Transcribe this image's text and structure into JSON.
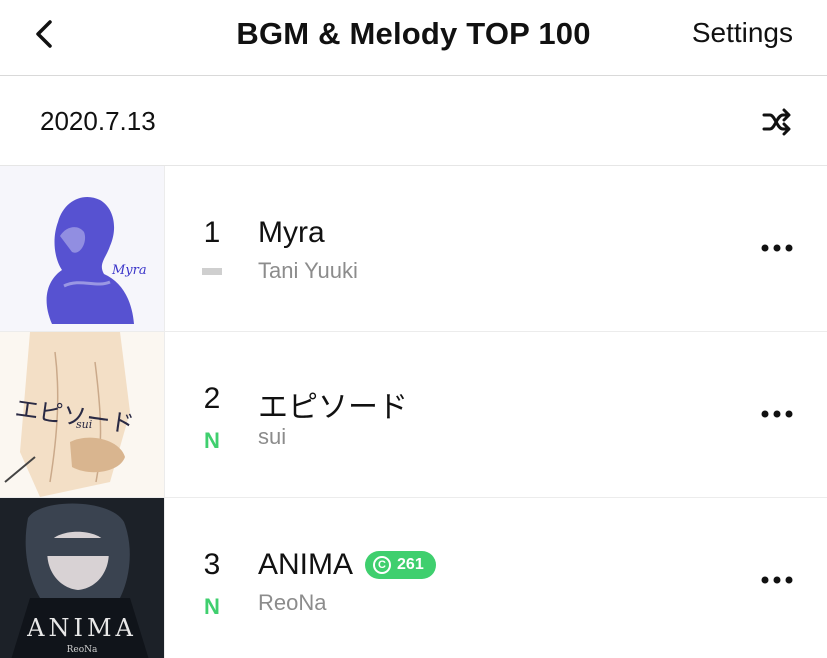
{
  "header": {
    "back_icon": "chevron-left-icon",
    "title": "BGM & Melody TOP 100",
    "settings_label": "Settings"
  },
  "date_bar": {
    "date": "2020.7.13",
    "shuffle_icon": "shuffle-icon"
  },
  "tracks": [
    {
      "rank": "1",
      "movement": "",
      "title": "Myra",
      "artist": "Tani Yuuki",
      "badge": "",
      "art_text": "Myra"
    },
    {
      "rank": "2",
      "movement": "N",
      "title": "エピソード",
      "artist": "sui",
      "badge": "",
      "art_text": "エピソード",
      "art_subtext": "sui"
    },
    {
      "rank": "3",
      "movement": "N",
      "title": "ANIMA",
      "artist": "ReoNa",
      "badge": "261",
      "art_text": "ANIMA",
      "art_subtext": "ReoNa"
    }
  ],
  "colors": {
    "new_green": "#3fcf6e",
    "artist_gray": "#8c8c8c",
    "divider": "#d9d9d9"
  }
}
